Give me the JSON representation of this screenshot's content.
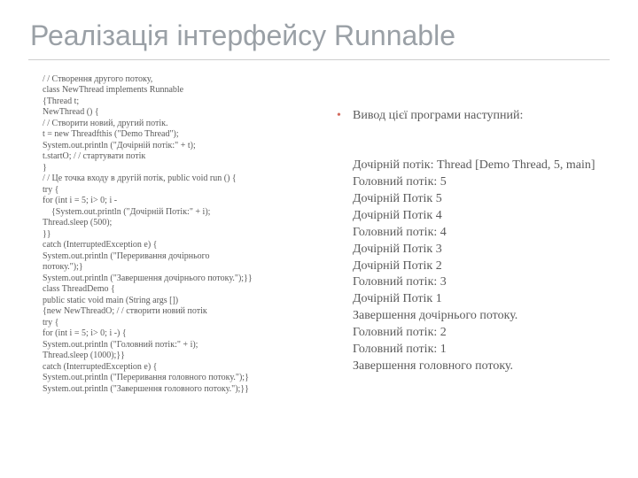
{
  "title": "Реалізація інтерфейсу Runnable",
  "code": "/ / Створення другого потоку,\nclass NewThread implements Runnable\n{Thread t;\nNewThread () {\n/ / Створити новий, другий потік.\nt = new Threadfthis (\"Demo Thread\");\nSystem.out.println (\"Дочірній потік:\" + t);\nt.startO; / / стартувати потік\n}\n/ / Це точка входу в другій потік, public void run () {\ntry {\nfor (int i = 5; i> 0; i -\n    {System.out.println (\"Дочірній Потік:\" + i);\nThread.sleep (500);\n}}\ncatch (InterruptedException e) {\nSystem.out.println (\"Переривання дочірнього\nпотоку.\");}\nSystem.out.println (\"Завершення дочірнього потоку.\");}}\nclass ThreadDemo {\npublic static void main (String args [])\n{new NewThreadO; / / створити новий потік\ntry {\nfor (int i = 5; i> 0; i -) {\nSystem.out.println (\"Головний потік:\" + i);\nThread.sleep (1000);}}\ncatch (InterruptedException e) {\nSystem.out.println (\"Переривання головного потоку.\");}\nSystem.out.println (\"Завершення головного потоку.\");}}",
  "output_header": "Вивод цієї програми наступний:",
  "output_rest": "Дочірній потік: Thread [Demo Thread, 5, main]\nГоловний потік: 5\nДочірній Потік 5\nДочірній Потік 4\nГоловний потік: 4\nДочірній Потік 3\nДочірній Потік 2\nГоловний потік: 3\nДочірній Потік 1\nЗавершення дочірнього потоку.\nГоловний потік: 2\nГоловний потік: 1\nЗавершення головного потоку."
}
